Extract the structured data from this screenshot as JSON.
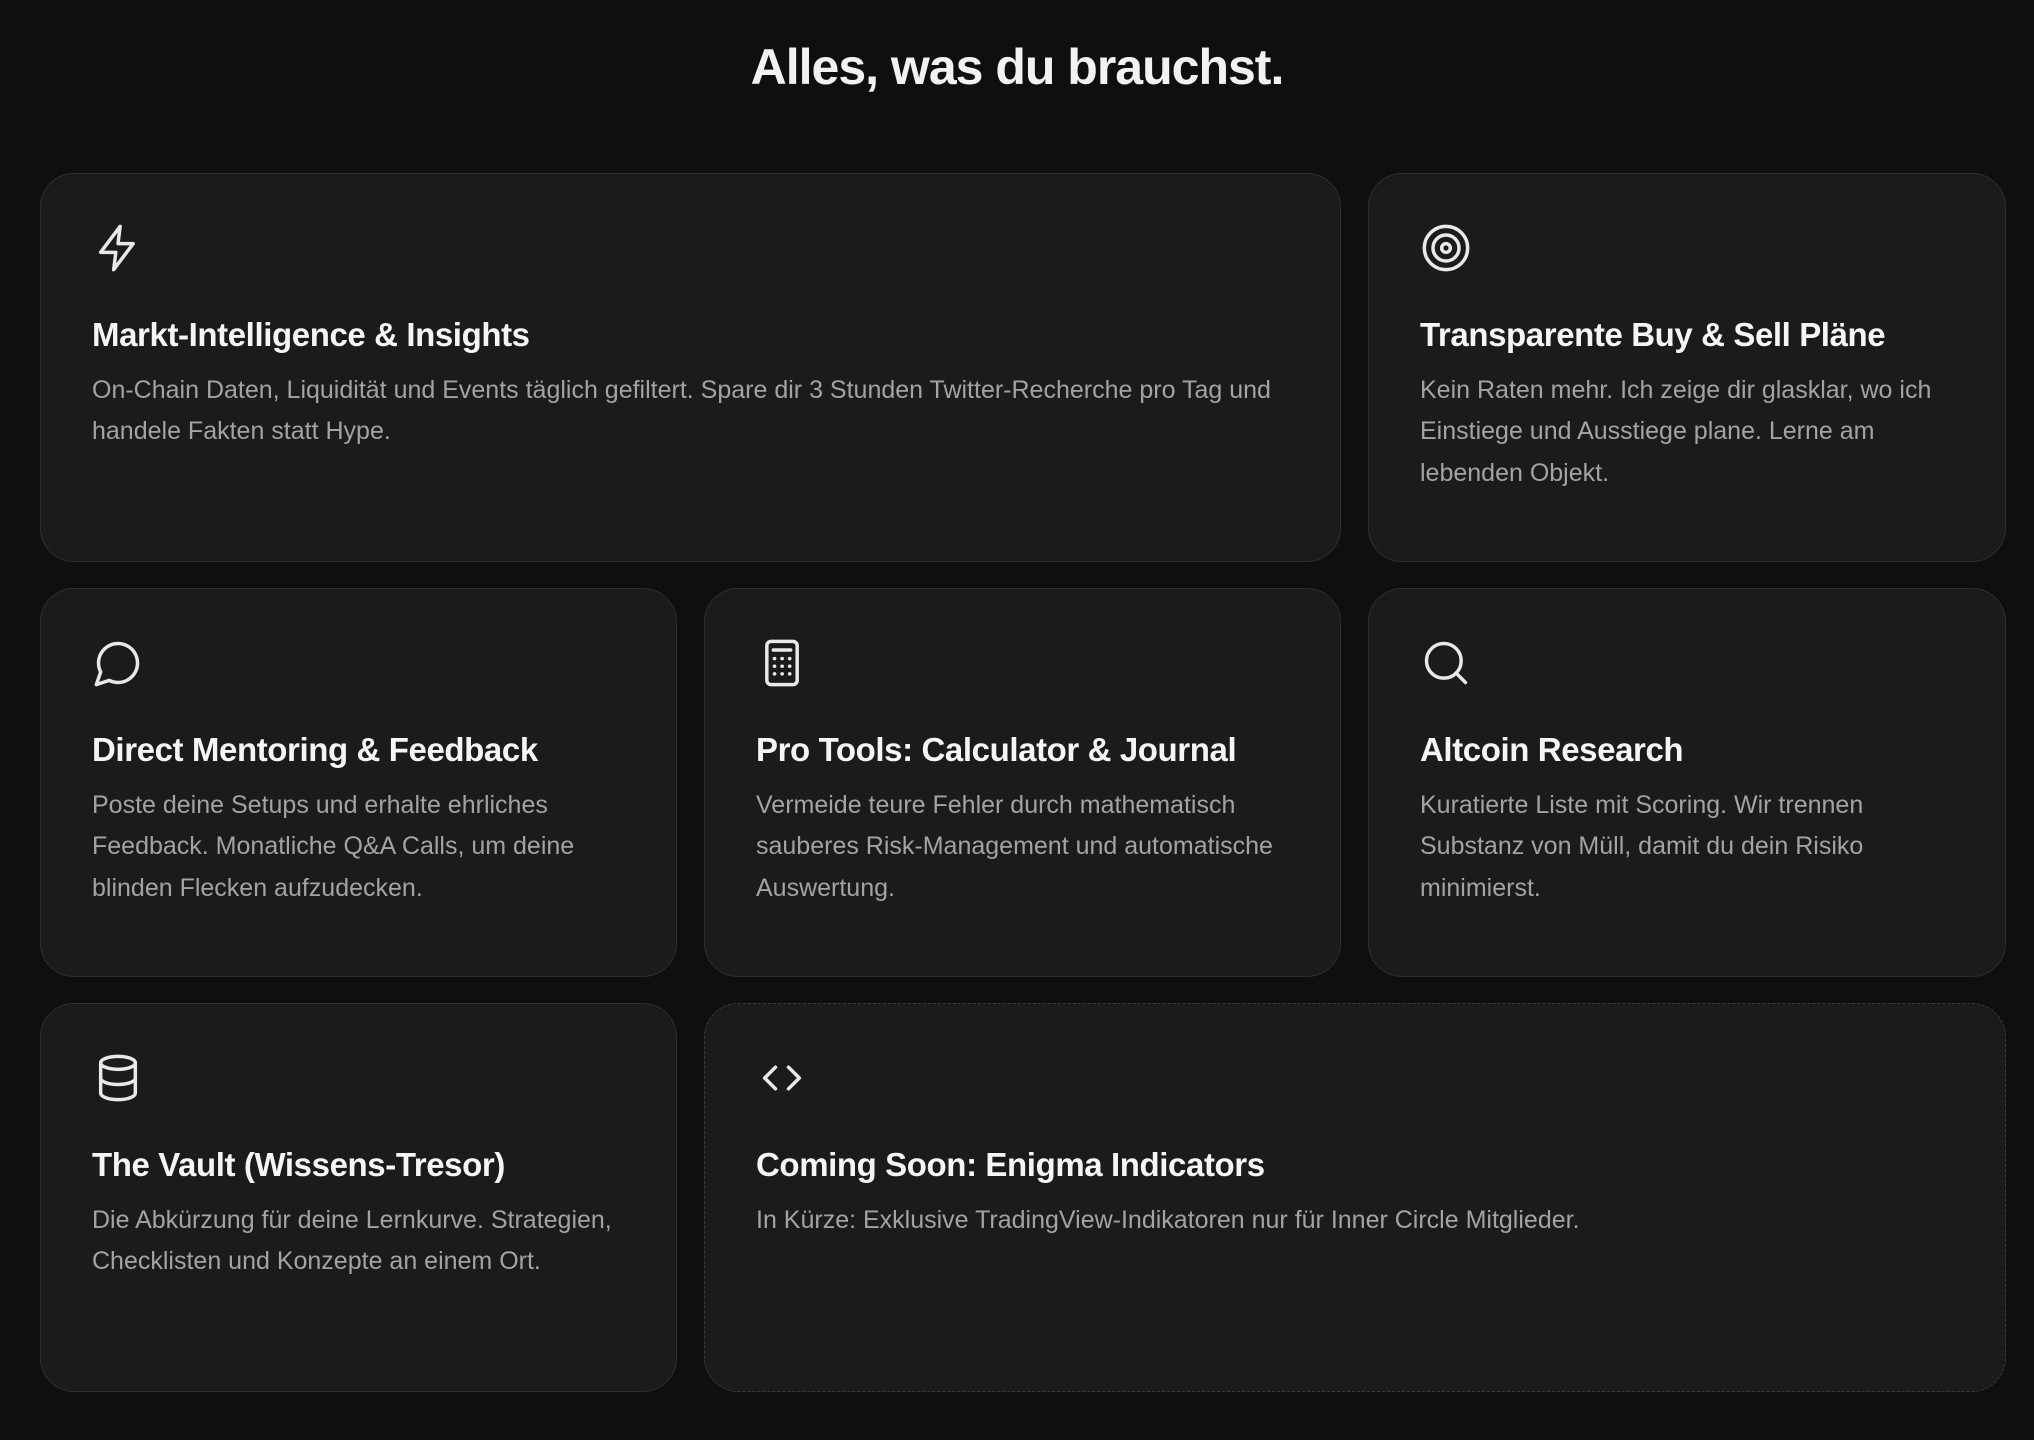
{
  "section": {
    "title": "Alles, was du brauchst."
  },
  "colors": {
    "background": "#0f0f10",
    "card": "#1b1b1c",
    "border": "#2f2f31",
    "title": "#f5f5f5",
    "text": "#a3a3a6"
  },
  "cards": [
    {
      "icon": "lightning-icon",
      "title": "Markt-Intelligence & Insights",
      "desc": "On-Chain Daten, Liquidität und Events täglich gefiltert. Spare dir 3 Stunden Twitter-Recherche pro Tag und handele Fakten statt Hype."
    },
    {
      "icon": "target-icon",
      "title": "Transparente Buy & Sell Pläne",
      "desc": "Kein Raten mehr. Ich zeige dir glasklar, wo ich Einstiege und Ausstiege plane. Lerne am lebenden Objekt."
    },
    {
      "icon": "chat-bubble-icon",
      "title": "Direct Mentoring & Feedback",
      "desc": "Poste deine Setups und erhalte ehrliches Feedback. Monatliche Q&A Calls, um deine blinden Flecken aufzudecken."
    },
    {
      "icon": "calculator-icon",
      "title": "Pro Tools: Calculator & Journal",
      "desc": "Vermeide teure Fehler durch mathematisch sauberes Risk-Management und automatische Auswertung."
    },
    {
      "icon": "search-icon",
      "title": "Altcoin Research",
      "desc": "Kuratierte Liste mit Scoring. Wir trennen Substanz von Müll, damit du dein Risiko minimierst."
    },
    {
      "icon": "database-icon",
      "title": "The Vault (Wissens-Tresor)",
      "desc": "Die Abkürzung für deine Lernkurve. Strategien, Checklisten und Konzepte an einem Ort."
    },
    {
      "icon": "code-icon",
      "title": "Coming Soon: Enigma Indicators",
      "desc": "In Kürze: Exklusive TradingView-Indikatoren nur für Inner Circle Mitglieder."
    }
  ]
}
